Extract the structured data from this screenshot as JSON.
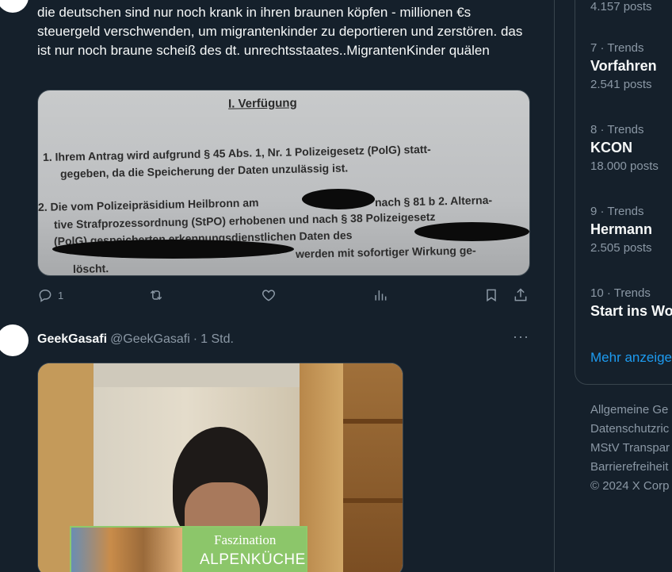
{
  "tweet1": {
    "text": "die deutschen sind nur noch krank in ihren braunen köpfen - millionen €s steuergeld verschwenden, um migrantenkinder zu deportieren und zerstören. das ist nur noch braune scheiß des dt. unrechtsstaates..MigrantenKinder quälen",
    "document": {
      "heading": "I. Verfügung",
      "line1a": "1.  Ihrem Antrag wird aufgrund § 45 Abs. 1, Nr. 1 Polizeigesetz (PolG) statt-",
      "line1b": "gegeben, da die Speicherung der Daten unzulässig ist.",
      "line2a": "2.  Die vom Polizeipräsidium Heilbronn am",
      "line2a_end": "nach § 81 b 2. Alterna-",
      "line2b": "tive Strafprozessordnung (StPO) erhobenen und nach § 38 Polizeigesetz",
      "line2c": "(PolG) gespeicherten erkennungsdienstlichen Daten des",
      "line2d": "werden mit sofortiger Wirkung ge-",
      "line2e": "löscht."
    },
    "actions": {
      "reply_count": "1"
    }
  },
  "tweet2": {
    "author_name": "GeekGasafi",
    "author_handle": "@GeekGasafi",
    "separator": "·",
    "time": "1 Std.",
    "book_title_1": "Faszination",
    "book_title_2": "ALPENKÜCHE"
  },
  "sidebar": {
    "top_posts": "4.157 posts",
    "trends": [
      {
        "meta": "7 · Trends",
        "name": "Vorfahren",
        "posts": "2.541 posts"
      },
      {
        "meta": "8 · Trends",
        "name": "KCON",
        "posts": "18.000 posts"
      },
      {
        "meta": "9 · Trends",
        "name": "Hermann",
        "posts": "2.505 posts"
      },
      {
        "meta": "10 · Trends",
        "name": "Start ins Wo",
        "posts": ""
      }
    ],
    "show_more": "Mehr anzeige",
    "footer": [
      "Allgemeine Ge",
      "Datenschutzric",
      "MStV Transpar",
      "Barrierefreiheit",
      "© 2024 X Corp"
    ]
  }
}
